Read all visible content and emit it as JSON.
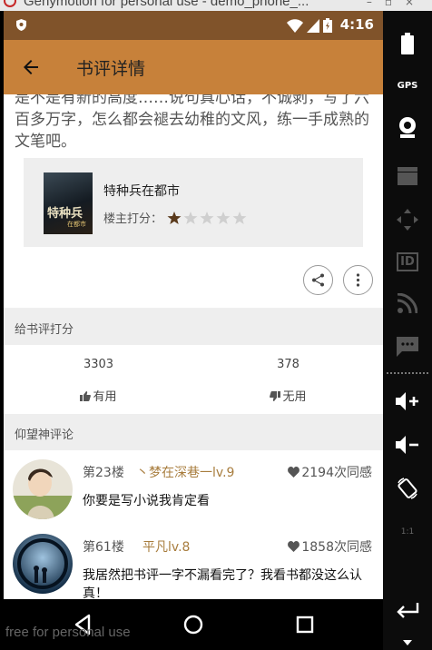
{
  "window": {
    "title": "Genymotion for personal use - demo_phone_..."
  },
  "status_bar": {
    "time": "4:16",
    "icons": [
      "shield-icon",
      "wifi-icon",
      "signal-icon",
      "battery-icon"
    ]
  },
  "app_bar": {
    "title": "书评详情",
    "back_icon": "arrow-back-icon"
  },
  "review": {
    "text": "是不是有新的高度……说句真心话，不诚剥，写了六百多万字，怎么都会褪去幼稚的文风，练一手成熟的文笔吧。"
  },
  "book": {
    "cover_text": "特种兵",
    "cover_subtext": "在都市",
    "name": "特种兵在都市",
    "rating_label": "楼主打分：",
    "rating": 1,
    "rating_max": 5
  },
  "actions": [
    "share-icon",
    "more-icon"
  ],
  "vote_section": {
    "header": "给书评打分",
    "useful": {
      "count": "3303",
      "label": "有用"
    },
    "useless": {
      "count": "378",
      "label": "无用"
    }
  },
  "comments_section": {
    "header": "仰望神评论",
    "items": [
      {
        "floor": "第23楼",
        "user": "丶梦在深巷一lv.9",
        "likes": "2194次同感",
        "text": "你要是写小说我肯定看"
      },
      {
        "floor": "第61楼",
        "user": "平凡lv.8",
        "likes": "1858次同感",
        "text": "我居然把书评一字不漏看完了？我看书都没这么认真！"
      }
    ]
  },
  "nav_bar": {
    "buttons": [
      "back-triangle-icon",
      "home-circle-icon",
      "recents-square-icon"
    ]
  },
  "watermark": "free for personal use",
  "emulator_sidebar": {
    "gps_label": "GPS",
    "id_label": "ID",
    "scale_label": "1:1"
  },
  "colors": {
    "status_bar": "#80532a",
    "app_bar": "#c7813a",
    "username": "#a87d3e",
    "star_filled": "#5a3a1c",
    "star_empty": "#cfcfcf"
  }
}
